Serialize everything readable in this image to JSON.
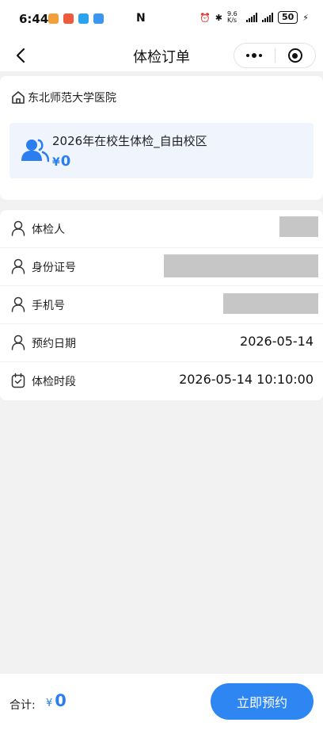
{
  "status_bar": {
    "time": "6:44",
    "network_speed": "9.6 K/s",
    "battery": "50"
  },
  "nav": {
    "title": "体检订单"
  },
  "hospital": {
    "name": "东北师范大学医院"
  },
  "package": {
    "name": "2026年在校生体检_自由校区",
    "currency": "¥",
    "price": "0"
  },
  "form": {
    "rows": [
      {
        "label": "体检人",
        "value": "",
        "redacted": true
      },
      {
        "label": "身份证号",
        "value": "",
        "redacted": true
      },
      {
        "label": "手机号",
        "value": "",
        "redacted": true
      },
      {
        "label": "预约日期",
        "value": "2026-05-14"
      },
      {
        "label": "体检时段",
        "value": "2026-05-14 10:10:00"
      }
    ]
  },
  "footer": {
    "total_label": "合计:",
    "currency": "¥",
    "total_value": "0",
    "book_label": "立即预约"
  },
  "colors": {
    "accent": "#2e86f3",
    "price": "#2b7ef0",
    "package_bg": "#f0f4fd"
  }
}
